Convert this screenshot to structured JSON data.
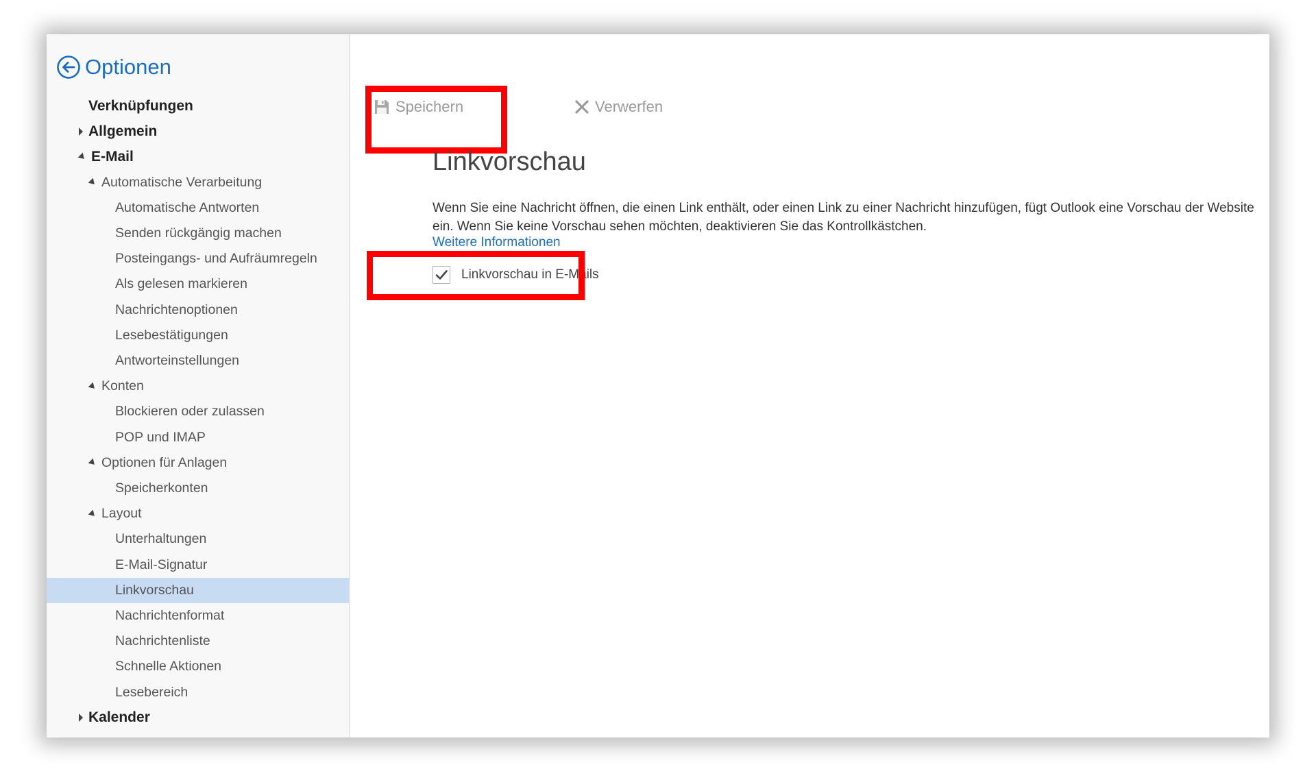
{
  "header": {
    "title": "Optionen"
  },
  "sidebar": {
    "items": [
      {
        "label": "Verknüpfungen",
        "level": 0
      },
      {
        "label": "Allgemein",
        "level": 0,
        "caret": "right"
      },
      {
        "label": "E-Mail",
        "level": 0,
        "caret": "down"
      },
      {
        "label": "Automatische Verarbeitung",
        "level": 1,
        "caret": "down"
      },
      {
        "label": "Automatische Antworten",
        "level": 2
      },
      {
        "label": "Senden rückgängig machen",
        "level": 2
      },
      {
        "label": "Posteingangs- und Aufräumregeln",
        "level": 2
      },
      {
        "label": "Als gelesen markieren",
        "level": 2
      },
      {
        "label": "Nachrichtenoptionen",
        "level": 2
      },
      {
        "label": "Lesebestätigungen",
        "level": 2
      },
      {
        "label": "Antworteinstellungen",
        "level": 2
      },
      {
        "label": "Konten",
        "level": 1,
        "caret": "down"
      },
      {
        "label": "Blockieren oder zulassen",
        "level": 2
      },
      {
        "label": "POP und IMAP",
        "level": 2
      },
      {
        "label": "Optionen für Anlagen",
        "level": 1,
        "caret": "down"
      },
      {
        "label": "Speicherkonten",
        "level": 2
      },
      {
        "label": "Layout",
        "level": 1,
        "caret": "down"
      },
      {
        "label": "Unterhaltungen",
        "level": 2
      },
      {
        "label": "E-Mail-Signatur",
        "level": 2
      },
      {
        "label": "Linkvorschau",
        "level": 2,
        "selected": true
      },
      {
        "label": "Nachrichtenformat",
        "level": 2
      },
      {
        "label": "Nachrichtenliste",
        "level": 2
      },
      {
        "label": "Schnelle Aktionen",
        "level": 2
      },
      {
        "label": "Lesebereich",
        "level": 2
      },
      {
        "label": "Kalender",
        "level": 0,
        "caret": "right"
      }
    ]
  },
  "toolbar": {
    "save_label": "Speichern",
    "save_icon": "floppy-disk-icon",
    "discard_label": "Verwerfen",
    "discard_icon": "close-icon"
  },
  "main": {
    "title": "Linkvorschau",
    "description": "Wenn Sie eine Nachricht öffnen, die einen Link enthält, oder einen Link zu einer Nachricht hinzufügen, fügt Outlook eine Vorschau der Website ein. Wenn Sie keine Vorschau sehen möchten, deaktivieren Sie das Kontrollkästchen.",
    "more_info_link": "Weitere Informationen",
    "checkbox": {
      "label": "Linkvorschau in E-Mails",
      "checked": true
    }
  },
  "colors": {
    "accent": "#1b6dc1",
    "highlight": "#ff0000",
    "selected_bg": "#c7dcf3",
    "sidebar_bg": "#f8f8f8"
  }
}
